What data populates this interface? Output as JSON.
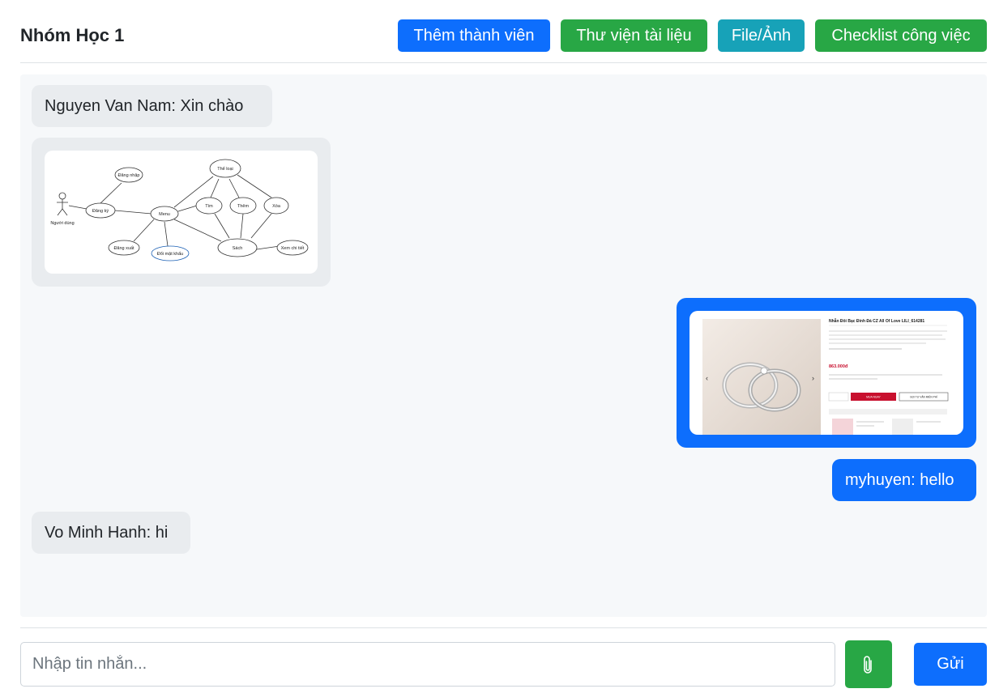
{
  "header": {
    "title": "Nhóm Học 1",
    "buttons": {
      "add_member": "Thêm thành viên",
      "library": "Thư viện tài liệu",
      "files": "File/Ảnh",
      "checklist": "Checklist công việc"
    }
  },
  "messages": [
    {
      "text": "Nguyen Van Nam: Xin chào",
      "side": "left"
    },
    {
      "image": "uml-use-case-diagram",
      "side": "left"
    },
    {
      "image": "product-page-screenshot",
      "side": "right"
    },
    {
      "text": "myhuyen: hello",
      "side": "right"
    },
    {
      "text": "Vo Minh Hanh: hi",
      "side": "left"
    }
  ],
  "diagram": {
    "actor": "Người dùng",
    "nodes": [
      "Đăng nhập",
      "Đăng ký",
      "Menu",
      "Thể loại",
      "Tìm",
      "Thêm",
      "Xóa",
      "Sách",
      "Xem chi tiết",
      "Đăng xuất",
      "Đổi mật khẩu"
    ]
  },
  "product": {
    "name": "Nhẫn Đôi Bạc Đính Đá CZ All Of Love LILI_614281",
    "price": "863.000đ",
    "buy_label": "MUA NGAY",
    "cart_label": "GỌI TƯ VẤN MIỄN PHÍ"
  },
  "composer": {
    "placeholder": "Nhập tin nhắn...",
    "send_label": "Gửi"
  },
  "colors": {
    "primary": "#0d6efd",
    "success": "#28a745",
    "info": "#17a2b8",
    "bubble_left": "#e9ecef"
  }
}
